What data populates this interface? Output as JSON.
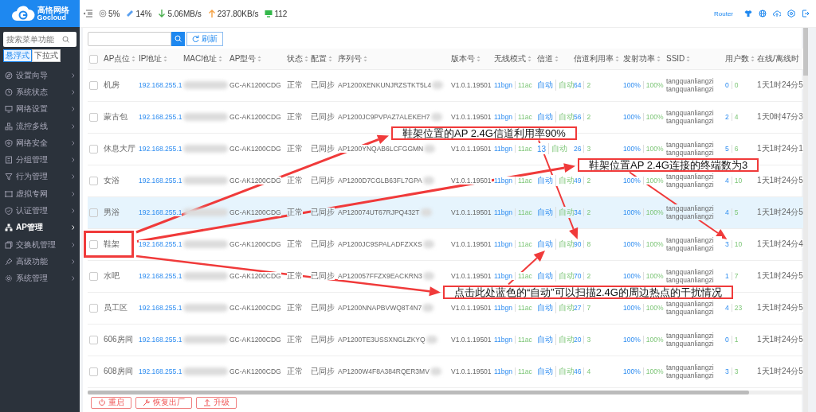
{
  "sidebar": {
    "brand": {
      "name": "高恪网络",
      "subtitle": "Gocloud"
    },
    "search": {
      "placeholder": "搜索菜单功能"
    },
    "modes": [
      {
        "label": "悬浮式",
        "selected": true
      },
      {
        "label": "下拉式",
        "selected": false
      }
    ],
    "items": [
      {
        "label": "设置向导",
        "selected": false
      },
      {
        "label": "系统状态",
        "selected": false
      },
      {
        "label": "网络设置",
        "selected": false
      },
      {
        "label": "流控多线",
        "selected": false
      },
      {
        "label": "网络安全",
        "selected": false
      },
      {
        "label": "分组管理",
        "selected": false
      },
      {
        "label": "行为管理",
        "selected": false
      },
      {
        "label": "虚拟专网",
        "selected": false
      },
      {
        "label": "认证管理",
        "selected": false
      },
      {
        "label": "AP管理",
        "selected": true
      },
      {
        "label": "交换机管理",
        "selected": false
      },
      {
        "label": "高级功能",
        "selected": false
      },
      {
        "label": "系统管理",
        "selected": false
      }
    ]
  },
  "topbar": {
    "stats": [
      {
        "kind": "cpu",
        "value": "5%"
      },
      {
        "kind": "memory",
        "value": "14%"
      },
      {
        "kind": "download",
        "value": "5.06MB/s"
      },
      {
        "kind": "upload",
        "value": "237.80KB/s"
      },
      {
        "kind": "clients",
        "value": "112"
      }
    ],
    "device": "Router"
  },
  "toolbar": {
    "refresh": "刷新"
  },
  "table": {
    "header_checked": false,
    "columns": [
      "AP点位",
      "IP地址",
      "MAC地址",
      "AP型号",
      "状态",
      "配置",
      "序列号",
      "版本号",
      "无线模式",
      "信道",
      "信道利用率",
      "发射功率",
      "SSID",
      "用户数",
      "在线/离线时"
    ],
    "rows": [
      {
        "checked": false,
        "highlighted": false,
        "location": "机房",
        "ip": "192.168.255.1",
        "model": "GC-AK1200CDG",
        "status": "正常",
        "config": "已同步",
        "serial": "AP1200XENKUNJRZSTKT5L4",
        "version": "V1.0.1.19501",
        "wireless": [
          "11bgn",
          "11ac"
        ],
        "channel": [
          "自动",
          "自动"
        ],
        "usage": [
          "64",
          "2"
        ],
        "power": [
          "100%",
          "100%"
        ],
        "ssid": [
          "tangquanliangzi",
          "tangquanliangzi"
        ],
        "users": [
          "0",
          "0"
        ],
        "online": "1天1时24分5"
      },
      {
        "checked": false,
        "highlighted": false,
        "location": "蒙古包",
        "ip": "192.168.255.1",
        "model": "GC-AK1200CDG",
        "status": "正常",
        "config": "已同步",
        "serial": "AP1200JC9PVPAZ7ALEKEH7",
        "version": "V1.0.1.19501",
        "wireless": [
          "11bgn",
          "11ac"
        ],
        "channel": [
          "自动",
          "自动"
        ],
        "usage": [
          "56",
          "2"
        ],
        "power": [
          "100%",
          "100%"
        ],
        "ssid": [
          "tangquanliangzi",
          "tangquanliangzi"
        ],
        "users": [
          "2",
          "4"
        ],
        "online": "1天0时47分3"
      },
      {
        "checked": false,
        "highlighted": false,
        "location": "休息大厅",
        "ip": "192.168.255.1",
        "model": "GC-AK1200CDG",
        "status": "正常",
        "config": "已同步",
        "serial": "AP1200YNQAB6LCFGGMN",
        "version": "V1.0.1.19501",
        "wireless": [
          "11bgn",
          "11ac"
        ],
        "channel": [
          "13",
          "自动"
        ],
        "usage": [
          "26",
          "3"
        ],
        "power": [
          "100%",
          "100%"
        ],
        "ssid": [
          "tangquanliangzi",
          "tangquanliangzi"
        ],
        "users": [
          "5",
          "6"
        ],
        "online": "1天1时24分1"
      },
      {
        "checked": false,
        "highlighted": false,
        "location": "女浴",
        "ip": "192.168.255.1",
        "model": "GC-AK1200CDG",
        "status": "正常",
        "config": "已同步",
        "serial": "AP1200D7CGLB63FL7GPA",
        "version": "V1.0.1.19501",
        "wireless": [
          "11bgn",
          "11ac"
        ],
        "channel": [
          "自动",
          "自动"
        ],
        "usage": [
          "49",
          "2"
        ],
        "power": [
          "100%",
          "100%"
        ],
        "ssid": [
          "tangquanliangzi",
          "tangquanliangzi"
        ],
        "users": [
          "4",
          "10"
        ],
        "online": "1天1时24分5"
      },
      {
        "checked": false,
        "highlighted": true,
        "location": "男浴",
        "ip": "192.168.255.1",
        "model": "GC-AK1200CDG",
        "status": "正常",
        "config": "已同步",
        "serial": "AP120074UT67RJPQ432T",
        "version": "V1.0.1.19501",
        "wireless": [
          "11bgn",
          "11ac"
        ],
        "channel": [
          "自动",
          "自动"
        ],
        "usage": [
          "34",
          "2"
        ],
        "power": [
          "100%",
          "100%"
        ],
        "ssid": [
          "tangquanliangzi",
          "tangquanliangzi"
        ],
        "users": [
          "4",
          "5"
        ],
        "online": "1天1时24分5"
      },
      {
        "checked": false,
        "highlighted": false,
        "location": "鞋架",
        "ip": "192.168.255.1",
        "model": "GC-AK1200CDG",
        "status": "正常",
        "config": "已同步",
        "serial": "AP1200JC9SPALADFZXXS",
        "version": "V1.0.1.19501",
        "wireless": [
          "11bgn",
          "11ac"
        ],
        "channel": [
          "自动",
          "自动"
        ],
        "usage": [
          "90",
          "8"
        ],
        "power": [
          "100%",
          "100%"
        ],
        "ssid": [
          "tangquanliangzi",
          "tangquanliangzi"
        ],
        "users": [
          "3",
          "10"
        ],
        "online": "1天1时24分4"
      },
      {
        "checked": false,
        "highlighted": false,
        "location": "水吧",
        "ip": "192.168.255.1",
        "model": "GC-AK1200CDG",
        "status": "正常",
        "config": "已同步",
        "serial": "AP120057FFZX9EACKRN3",
        "version": "V1.0.1.19501",
        "wireless": [
          "11bgn",
          "11ac"
        ],
        "channel": [
          "自动",
          "自动"
        ],
        "usage": [
          "70",
          "2"
        ],
        "power": [
          "100%",
          "100%"
        ],
        "ssid": [
          "tangquanliangzi",
          "tangquanliangzi"
        ],
        "users": [
          "1",
          "7"
        ],
        "online": "1天1时24分5"
      },
      {
        "checked": false,
        "highlighted": false,
        "location": "员工区",
        "ip": "192.168.255.1",
        "model": "GC-AK1200CDG",
        "status": "正常",
        "config": "已同步",
        "serial": "AP1200NNAPBVWQ8T4N7",
        "version": "V1.0.1.19501",
        "wireless": [
          "11bgn",
          "11ac"
        ],
        "channel": [
          "自动",
          "自动"
        ],
        "usage": [
          "27",
          "7"
        ],
        "power": [
          "100%",
          "100%"
        ],
        "ssid": [
          "tangquanliangzi",
          "tangquanliangzi"
        ],
        "users": [
          "4",
          "23"
        ],
        "online": "1天1时24分5"
      },
      {
        "checked": false,
        "highlighted": false,
        "location": "606房间",
        "ip": "192.168.255.1",
        "model": "GC-AK1200CDG",
        "status": "正常",
        "config": "已同步",
        "serial": "AP1200TE3USSXNGLZKYQ",
        "version": "V1.0.1.19501",
        "wireless": [
          "11bgn",
          "11ac"
        ],
        "channel": [
          "自动",
          "自动"
        ],
        "usage": [
          "20",
          "3"
        ],
        "power": [
          "100%",
          "100%"
        ],
        "ssid": [
          "tangquanliangzi",
          "tangquanliangzi"
        ],
        "users": [
          "0",
          "1"
        ],
        "online": "1天1时24分5"
      },
      {
        "checked": false,
        "highlighted": false,
        "location": "608房间",
        "ip": "192.168.255.1",
        "model": "GC-AK1200CDG",
        "status": "正常",
        "config": "已同步",
        "serial": "AP1200W4F8A384RQER3MV",
        "version": "V1.0.1.19501",
        "wireless": [
          "11bgn",
          "11ac"
        ],
        "channel": [
          "自动",
          "自动"
        ],
        "usage": [
          "46",
          "4"
        ],
        "power": [
          "100%",
          "100%"
        ],
        "ssid": [
          "tangquanliangzi",
          "tangquanliangzi"
        ],
        "users": [
          "3",
          "3"
        ],
        "online": "1天1时24分5"
      }
    ]
  },
  "actions": [
    {
      "kind": "reboot",
      "label": "重启"
    },
    {
      "kind": "reset",
      "label": "恢复出厂"
    },
    {
      "kind": "upgrade",
      "label": "升级"
    }
  ],
  "annotations": [
    {
      "text": "鞋架位置的AP 2.4G信道利用率90%"
    },
    {
      "text": "鞋架位置AP 2.4G连接的终端数为3"
    },
    {
      "text": "点击此处蓝色的“自动”可以扫描2.4G的周边热点的干扰情况"
    }
  ]
}
